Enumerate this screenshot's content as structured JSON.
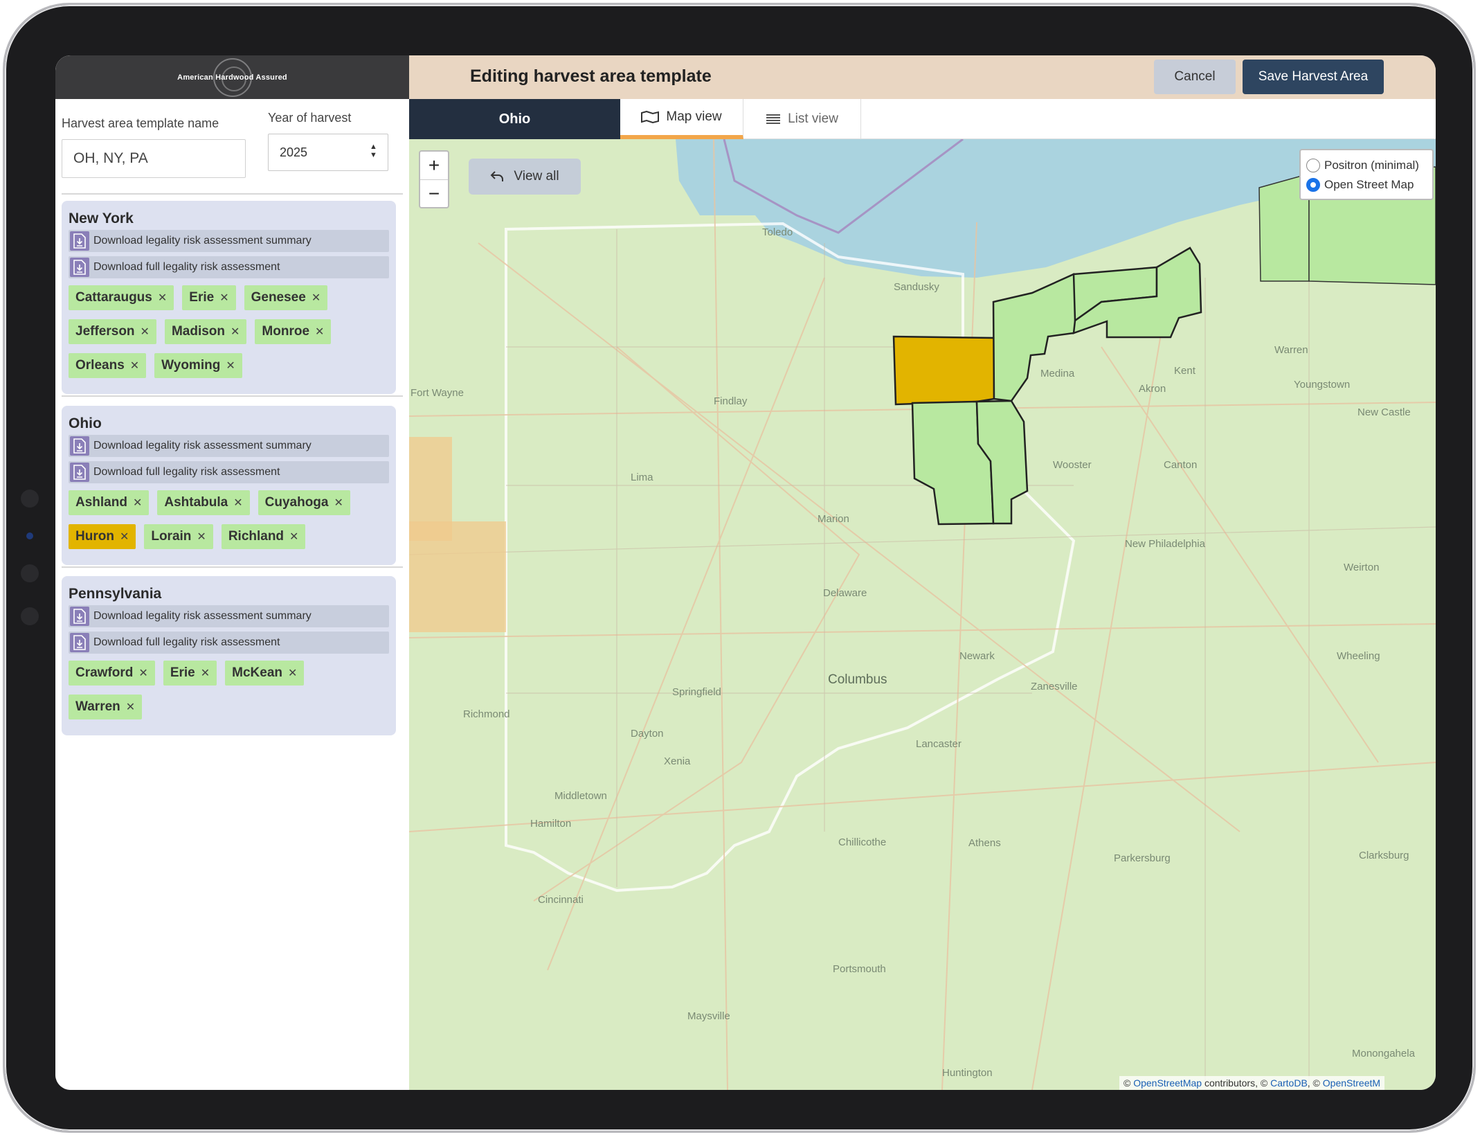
{
  "app": {
    "logo_text": "American Hardwood Assured",
    "header_title": "Editing harvest area template",
    "cancel_label": "Cancel",
    "save_label": "Save Harvest Area"
  },
  "form": {
    "name_label": "Harvest area template name",
    "name_value": "OH, NY, PA",
    "year_label": "Year of harvest",
    "year_value": "2025"
  },
  "groups": [
    {
      "title": "New York",
      "download_summary": "Download legality risk assessment summary",
      "download_full": "Download full legality risk assessment",
      "counties": [
        "Cattaraugus",
        "Erie",
        "Genesee",
        "Jefferson",
        "Madison",
        "Monroe",
        "Orleans",
        "Wyoming"
      ]
    },
    {
      "title": "Ohio",
      "download_summary": "Download legality risk assessment summary",
      "download_full": "Download full legality risk assessment",
      "counties": [
        "Ashland",
        "Ashtabula",
        "Cuyahoga",
        "Huron",
        "Lorain",
        "Richland"
      ],
      "selected": "Huron"
    },
    {
      "title": "Pennsylvania",
      "download_summary": "Download legality risk assessment summary",
      "download_full": "Download full legality risk assessment",
      "counties": [
        "Crawford",
        "Erie",
        "McKean",
        "Warren"
      ]
    }
  ],
  "tabs": {
    "state": "Ohio",
    "map": "Map view",
    "list": "List view"
  },
  "map": {
    "zoom_in": "+",
    "zoom_out": "−",
    "view_all": "View all",
    "layers": [
      "Positron (minimal)",
      "Open Street Map"
    ],
    "active_layer": "Open Street Map",
    "attribution": {
      "prefix": "© ",
      "osm": "OpenStreetMap",
      "mid": " contributors, © ",
      "carto": "CartoDB",
      "sep": ", © ",
      "osm2": "OpenStreetM"
    },
    "places": {
      "toledo": "Toledo",
      "sandusky": "Sandusky",
      "fort_wayne": "Fort Wayne",
      "findlay": "Findlay",
      "lima": "Lima",
      "marion": "Marion",
      "delaware": "Delaware",
      "columbus": "Columbus",
      "springfield": "Springfield",
      "dayton": "Dayton",
      "xenia": "Xenia",
      "richmond": "Richmond",
      "middletown": "Middletown",
      "hamilton": "Hamilton",
      "cincinnati": "Cincinnati",
      "chillicothe": "Chillicothe",
      "lancaster": "Lancaster",
      "newark": "Newark",
      "zanesville": "Zanesville",
      "athens": "Athens",
      "parkersburg": "Parkersburg",
      "portsmouth": "Portsmouth",
      "maysville": "Maysville",
      "huntington": "Huntington",
      "medina": "Medina",
      "akron": "Akron",
      "kent": "Kent",
      "canton": "Canton",
      "wooster": "Wooster",
      "youngstown": "Youngstown",
      "warren": "Warren",
      "new_castle": "New Castle",
      "new_philadelphia": "New Philadelphia",
      "wheeling": "Wheeling",
      "weirton": "Weirton",
      "clarksburg": "Clarksburg",
      "monongahela": "Monongahela"
    }
  },
  "colors": {
    "chip_green": "#b8e8a0",
    "chip_selected": "#e2b400",
    "header_bg": "#e9d6c2",
    "save_btn": "#2e4560",
    "tab_active_accent": "#f2a64a"
  }
}
